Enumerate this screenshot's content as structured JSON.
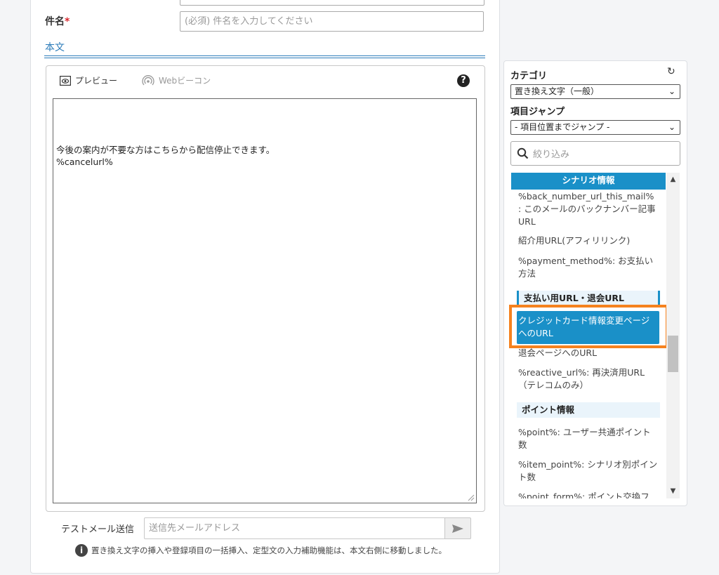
{
  "form": {
    "subject_label": "件名",
    "required_mark": "*",
    "subject_placeholder": "(必須) 件名を入力してください",
    "body_heading": "本文"
  },
  "editor": {
    "preview_label": "プレビュー",
    "web_beacon_label": "Webビーコン",
    "help_glyph": "?",
    "lines": [
      "今後の案内が不要な方はこちらから配信停止できます。",
      "%cancelurl%"
    ]
  },
  "test_mail": {
    "label": "テストメール送信",
    "placeholder": "送信先メールアドレス"
  },
  "notice": {
    "text": "置き換え文字の挿入や登録項目の一括挿入、定型文の入力補助機能は、本文右側に移動しました。"
  },
  "side_panel": {
    "category_label": "カテゴリ",
    "category_value": "置き換え文字（一般）",
    "jump_label": "項目ジャンプ",
    "jump_value": "- 項目位置までジャンプ -",
    "filter_placeholder": "絞り込み",
    "sections": {
      "scenario": "シナリオ情報",
      "payment": "支払い用URL・退会URL",
      "points": "ポイント情報"
    },
    "items": {
      "backnumber": "%back_number_url_this_mail% : このメールのバックナンバー記事URL",
      "affiliate": "紹介用URL(アフィリリンク)",
      "payment_method": "%payment_method%: お支払い方法",
      "credit_card": "クレジットカード情報変更ページへのURL",
      "withdraw": "退会ページへのURL",
      "reactive": "%reactive_url%: 再決済用URL（テレコムのみ）",
      "point": "%point%: ユーザー共通ポイント数",
      "item_point": "%item_point%: シナリオ別ポイント数",
      "point_form": "%point_form%: ポイント交換フ"
    }
  },
  "colors": {
    "accent": "#1a90c8",
    "highlight": "#f5821f",
    "required": "#d9282f"
  }
}
